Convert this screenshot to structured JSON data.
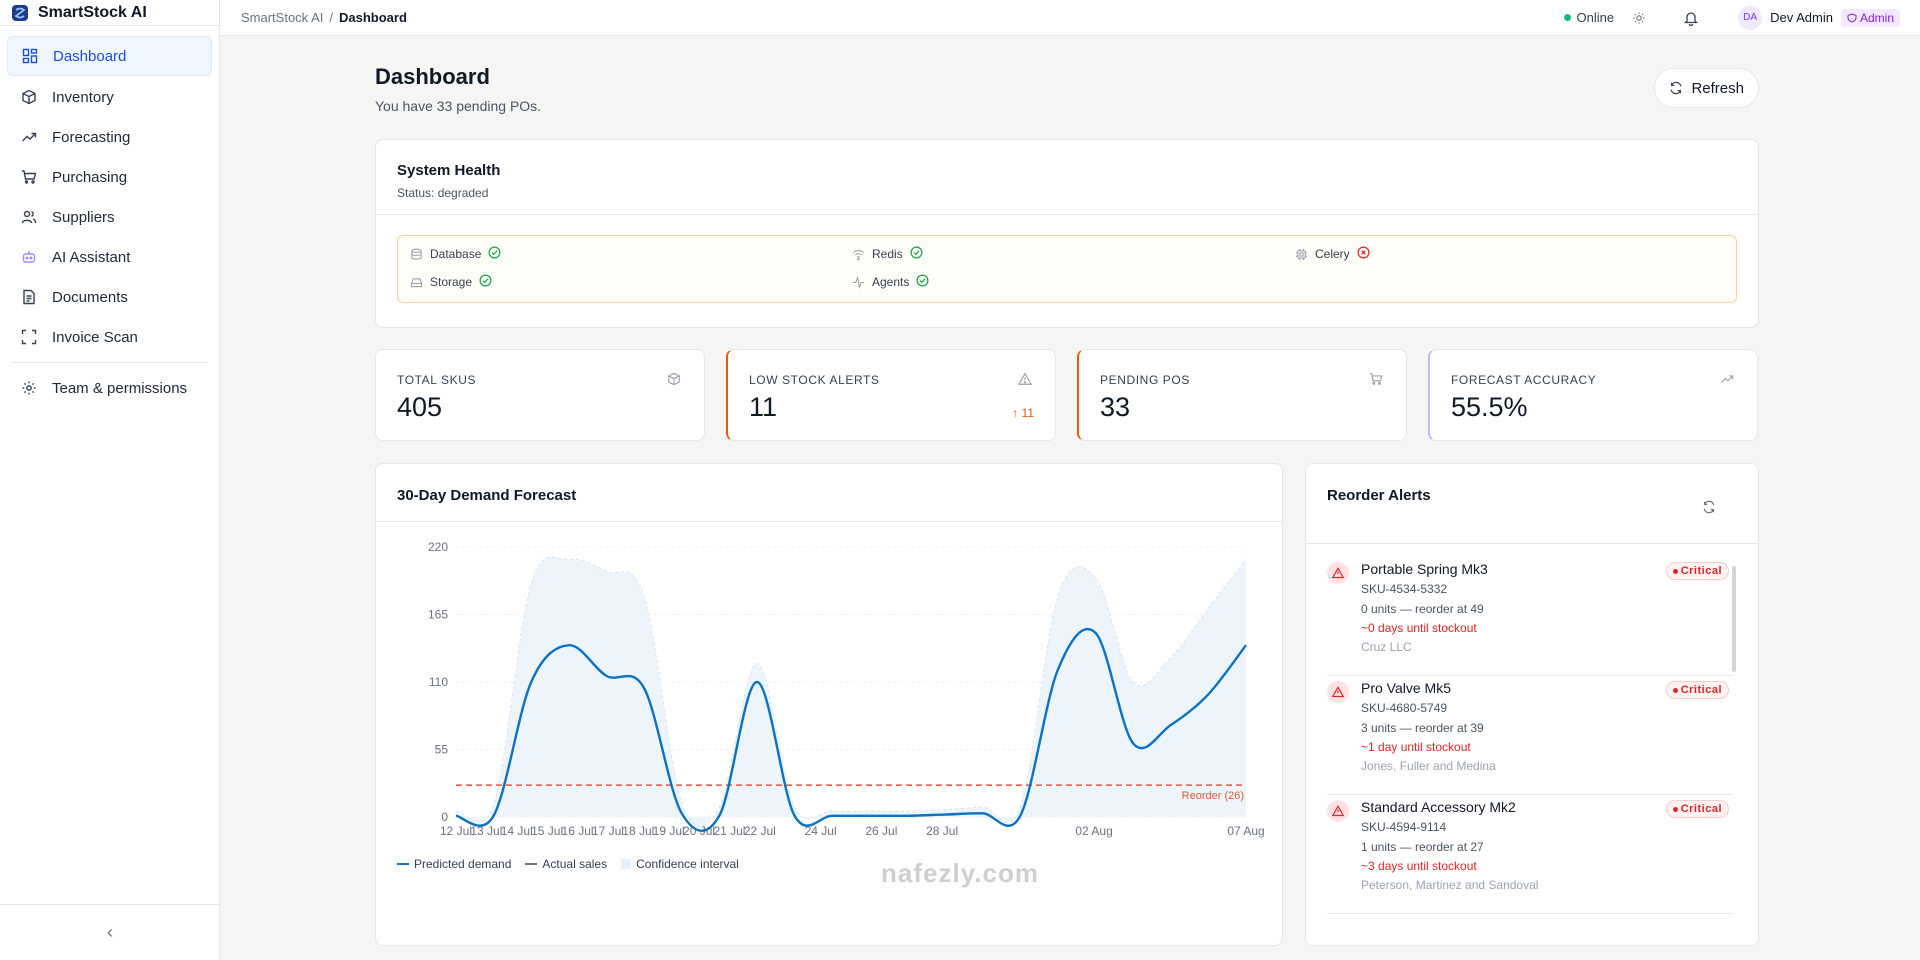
{
  "app": {
    "name": "SmartStock AI"
  },
  "sidebar": {
    "items": [
      {
        "label": "Dashboard",
        "icon": "dashboard-icon"
      },
      {
        "label": "Inventory",
        "icon": "box-icon"
      },
      {
        "label": "Forecasting",
        "icon": "trending-up-icon"
      },
      {
        "label": "Purchasing",
        "icon": "cart-icon"
      },
      {
        "label": "Suppliers",
        "icon": "users-icon"
      },
      {
        "label": "AI Assistant",
        "icon": "bot-icon"
      },
      {
        "label": "Documents",
        "icon": "document-icon"
      },
      {
        "label": "Invoice Scan",
        "icon": "scan-icon"
      }
    ],
    "settings_item": {
      "label": "Team & permissions",
      "icon": "gear-icon"
    },
    "collapse_glyph": "‹"
  },
  "header": {
    "breadcrumb_root": "SmartStock AI",
    "breadcrumb_sep": "/",
    "breadcrumb_current": "Dashboard",
    "status": "Online",
    "user_initials": "DA",
    "user_name": "Dev Admin",
    "role": "Admin"
  },
  "page": {
    "title": "Dashboard",
    "subtitle": "You have 33 pending POs.",
    "refresh_label": "Refresh"
  },
  "health": {
    "title": "System Health",
    "status": "Status: degraded",
    "services": [
      {
        "name": "Database",
        "ok": true
      },
      {
        "name": "Redis",
        "ok": true
      },
      {
        "name": "Celery",
        "ok": false
      },
      {
        "name": "Storage",
        "ok": true
      },
      {
        "name": "Agents",
        "ok": true
      }
    ]
  },
  "stats": [
    {
      "label": "TOTAL SKUS",
      "value": "405",
      "icon": "package-icon"
    },
    {
      "label": "LOW STOCK ALERTS",
      "value": "11",
      "delta": "11",
      "icon": "warning-icon"
    },
    {
      "label": "PENDING POS",
      "value": "33",
      "icon": "cart-icon"
    },
    {
      "label": "FORECAST ACCURACY",
      "value": "55.5%",
      "icon": "trending-up-icon"
    }
  ],
  "forecast": {
    "title": "30-Day Demand Forecast",
    "legend": [
      "Predicted demand",
      "Actual sales",
      "Confidence interval"
    ]
  },
  "chart_data": {
    "type": "line",
    "x": [
      "12 Jul",
      "13 Jul",
      "14 Jul",
      "15 Jul",
      "16 Jul",
      "17 Jul",
      "18 Jul",
      "19 Jul",
      "20 Jul",
      "21 Jul",
      "22 Jul",
      "23 Jul",
      "24 Jul",
      "25 Jul",
      "26 Jul",
      "27 Jul",
      "28 Jul",
      "29 Jul",
      "30 Jul",
      "31 Jul",
      "01 Aug",
      "02 Aug",
      "03 Aug",
      "04 Aug",
      "05 Aug",
      "06 Aug",
      "07 Aug"
    ],
    "x_tick_labels": [
      "12 Jul",
      "13 Jul",
      "14 Jul",
      "15 Jul",
      "16 Jul",
      "17 Jul",
      "18 Jul",
      "19 Jul",
      "20 Jul",
      "21 Jul",
      "22 Jul",
      "24 Jul",
      "26 Jul",
      "28 Jul",
      "02 Aug",
      "07 Aug"
    ],
    "yticks": [
      0,
      55,
      110,
      165,
      220
    ],
    "ylim": [
      0,
      220
    ],
    "series": [
      {
        "name": "Predicted demand",
        "values": [
          1,
          1,
          110,
          140,
          115,
          105,
          3,
          1,
          110,
          1,
          1,
          1,
          1,
          2,
          3,
          1,
          120,
          150,
          60,
          75,
          100,
          140
        ]
      },
      {
        "name": "Confidence interval",
        "upper": [
          5,
          10,
          190,
          210,
          200,
          180,
          12,
          8,
          125,
          8,
          5,
          5,
          5,
          6,
          8,
          8,
          180,
          195,
          110,
          130,
          170,
          210
        ],
        "lower": [
          0,
          0,
          60,
          80,
          60,
          55,
          0,
          0,
          80,
          0,
          0,
          0,
          0,
          0,
          0,
          0,
          70,
          100,
          25,
          30,
          60,
          80
        ]
      }
    ],
    "reorder_line": {
      "value": 26,
      "label": "Reorder (26)"
    }
  },
  "alerts": {
    "title": "Reorder Alerts",
    "items": [
      {
        "name": "Portable Spring Mk3",
        "sku": "SKU-4534-5332",
        "units": "0 units — reorder at 49",
        "stockout": "~0 days until stockout",
        "supplier": "Cruz LLC",
        "badge": "Critical"
      },
      {
        "name": "Pro Valve Mk5",
        "sku": "SKU-4680-5749",
        "units": "3 units — reorder at 39",
        "stockout": "~1 day until stockout",
        "supplier": "Jones, Fuller and Medina",
        "badge": "Critical"
      },
      {
        "name": "Standard Accessory Mk2",
        "sku": "SKU-4594-9114",
        "units": "1 units — reorder at 27",
        "stockout": "~3 days until stockout",
        "supplier": "Peterson, Martinez and Sandoval",
        "badge": "Critical"
      }
    ]
  },
  "watermark": "nafezly.com"
}
